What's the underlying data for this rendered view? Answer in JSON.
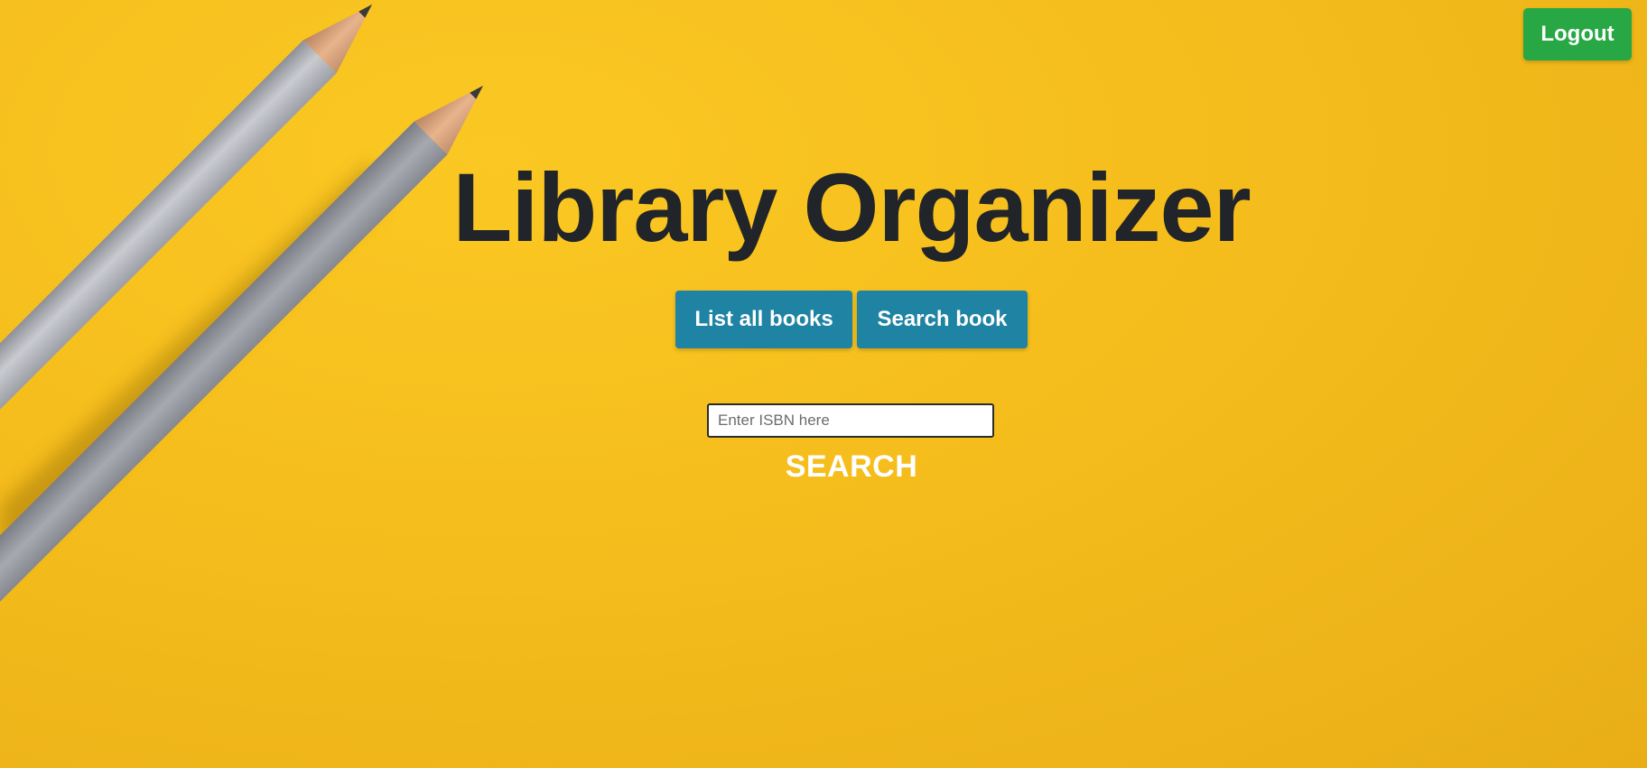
{
  "page": {
    "title": "Library Organizer",
    "background_color": "#f2b91b"
  },
  "header": {
    "logout_label": "Logout",
    "logout_color": "#28a745"
  },
  "nav": {
    "list_all_label": "List all books",
    "search_book_label": "Search book",
    "button_color": "#1f83a3"
  },
  "search": {
    "placeholder": "Enter ISBN here",
    "value": "",
    "submit_label": "SEARCH"
  },
  "decor": {
    "image_icon": "pencils-illustration"
  }
}
